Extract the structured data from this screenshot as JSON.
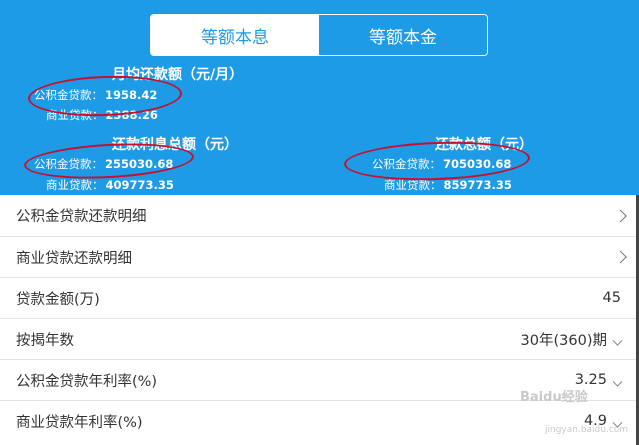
{
  "tabs": [
    "等额本息",
    "等额本金"
  ],
  "summary": {
    "monthly": {
      "title": "月均还款额（元/月）",
      "fund_label": "公积金贷款：",
      "fund_value": "1958.42",
      "commercial_label": "商业贷款：",
      "commercial_value": "2388.26"
    },
    "interest": {
      "title": "还款利息总额（元）",
      "fund_label": "公积金贷款：",
      "fund_value": "255030.68",
      "commercial_label": "商业贷款：",
      "commercial_value": "409773.35"
    },
    "total": {
      "title": "还款总额（元）",
      "fund_label": "公积金贷款：",
      "fund_value": "705030.68",
      "commercial_label": "商业贷款：",
      "commercial_value": "859773.35"
    }
  },
  "rows": [
    {
      "label": "公积金贷款还款明细",
      "value": ""
    },
    {
      "label": "商业贷款还款明细",
      "value": ""
    },
    {
      "label": "贷款金额(万)",
      "value": "45"
    },
    {
      "label": "按揭年数",
      "value": "30年(360)期"
    },
    {
      "label": "公积金贷款年利率(%)",
      "value": "3.25"
    },
    {
      "label": "商业贷款年利率(%)",
      "value": "4.9"
    }
  ],
  "watermark": {
    "brand": "Baidu经验",
    "url": "jingyan.baidu.com"
  },
  "colors": {
    "accent": "#1e9be6",
    "annotation": "#c8102e"
  }
}
